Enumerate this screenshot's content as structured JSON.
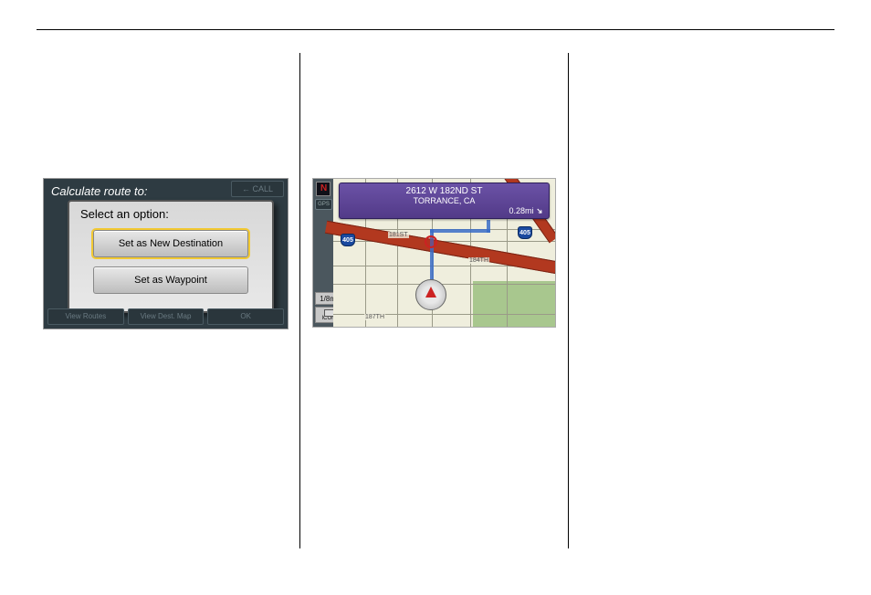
{
  "shot1": {
    "header": "Calculate route to:",
    "call_btn": "← CALL",
    "dialog_title": "Select an option:",
    "btn1": "Set as New Destination",
    "btn2": "Set as Waypoint",
    "bottom": {
      "b1": "View Routes",
      "b2": "View Dest. Map",
      "b3": "OK"
    }
  },
  "shot2": {
    "north": "N",
    "gps": "GPS",
    "scale": "1/8mi",
    "icon": "ICON",
    "address_line1": "2612 W 182ND ST",
    "address_line2": "TORRANCE, CA",
    "distance": "0.28mi",
    "shield": "405",
    "street1": "181ST",
    "street2": "184TH",
    "street3": "187TH"
  }
}
